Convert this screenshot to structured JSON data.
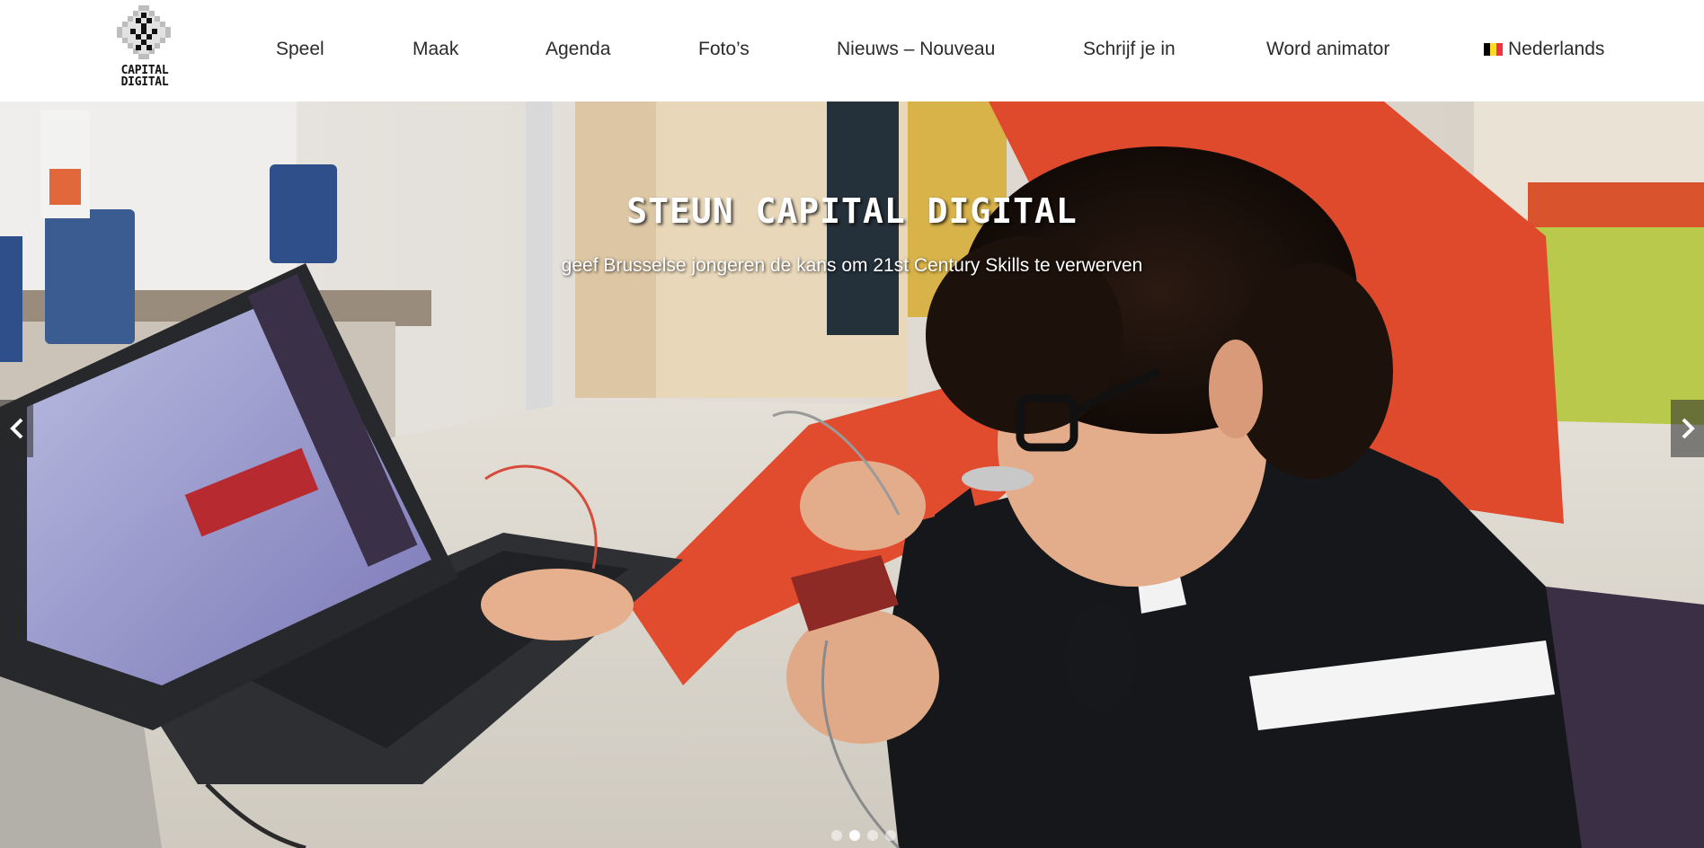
{
  "brand": {
    "logo_line1": "CAPITAL",
    "logo_line2": "DIGITAL"
  },
  "nav": {
    "items": [
      {
        "label": "Speel"
      },
      {
        "label": "Maak"
      },
      {
        "label": "Agenda"
      },
      {
        "label": "Foto’s"
      },
      {
        "label": "Nieuws – Nouveau"
      },
      {
        "label": "Schrijf je in"
      },
      {
        "label": "Word animator"
      }
    ],
    "language": {
      "label": "Nederlands",
      "flag_icon": "belgium-flag-icon",
      "flag_colors": [
        "#000000",
        "#FDDA24",
        "#EF3340"
      ]
    }
  },
  "hero": {
    "title": "STEUN CAPITAL DIGITAL",
    "subtitle": "geef Brusselse jongeren de kans om 21st Century Skills te verwerven",
    "prev_icon": "chevron-left-icon",
    "next_icon": "chevron-right-icon",
    "slides": 4,
    "active_slide": 1
  },
  "colors": {
    "nav_text": "#2b2b2b",
    "header_bg": "#ffffff",
    "caption_text": "#ffffff"
  }
}
